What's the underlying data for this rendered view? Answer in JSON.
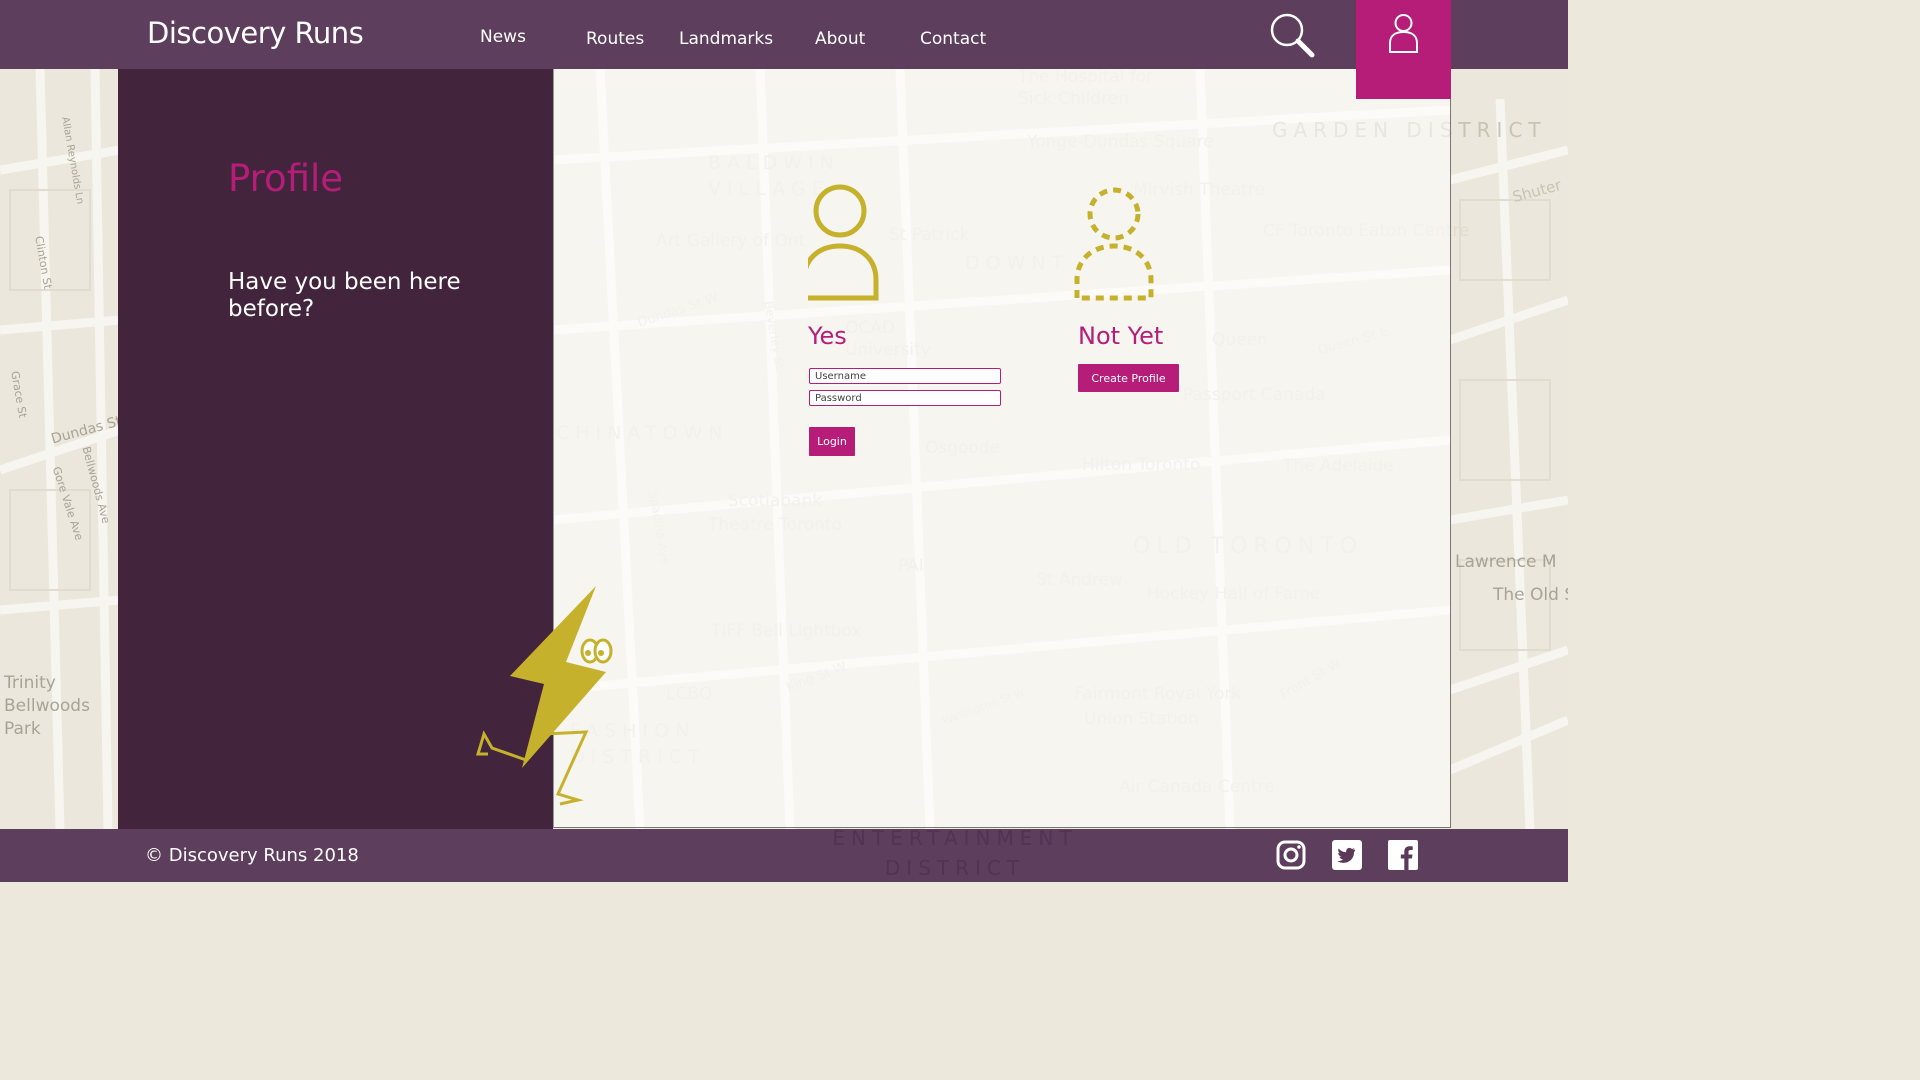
{
  "brand": "Discovery Runs",
  "nav": {
    "items": [
      "News",
      "Routes",
      "Landmarks",
      "About",
      "Contact"
    ]
  },
  "header_icons": {
    "search": "search-icon",
    "profile": "user-icon"
  },
  "side_panel": {
    "title": "Profile",
    "question": "Have you been here before?"
  },
  "login": {
    "title": "Yes",
    "username_placeholder": "Username",
    "password_placeholder": "Password",
    "button_label": "Login"
  },
  "signup": {
    "title": "Not Yet",
    "button_label": "Create Profile"
  },
  "map_labels": {
    "baldwin_village": "BALDWIN VILLAGE",
    "downtown": "DOWNT",
    "garden_district": "GARDEN DISTRICT",
    "chinatown": "CHINATOWN",
    "old_toronto": "OLD TORONTO",
    "fashion_district": "FASHION DISTRICT",
    "entertainment_district": "ENTERTAINMENT DISTRICT",
    "sick_children": "The Hospital for Sick Children",
    "yonge_dundas": "Yonge-Dundas Square",
    "mirvish": "Mirvish Theatre",
    "eaton_centre": "CF Toronto Eaton Centre",
    "art_gallery": "Art Gallery of Ont",
    "st_patrick": "St Patrick",
    "ocad": "OCAD University",
    "dundas_square": "Dundas Square",
    "queen": "Queen",
    "passport_canada": "Passport Canada",
    "osgoode": "Osgoode",
    "hilton": "Hilton Toronto",
    "adelaide": "The Adelaide",
    "scotiabank": "Scotiabank Theatre Toronto",
    "pai": "PAI",
    "st_andrew": "St Andrew",
    "hockey_hall": "Hockey Hall of Fame",
    "tiff": "TIFF Bell Lightbox",
    "lcbo": "LCBO",
    "fairmont": "Fairmont Royal York",
    "union_station": "Union Station",
    "air_canada": "Air Canada Centre",
    "trinity": "Trinity Bellwoods Park",
    "lawrence": "Lawrence M",
    "old_spaghetti": "The Old Spaghet",
    "dundas_st_w": "Dundas St W",
    "king_st_w": "King St W",
    "queen_st_e": "Queen St E",
    "front_st_w": "Front St W",
    "wellington_st_w": "Wellington St W",
    "spadina_ave": "Spadina Ave",
    "beverley_st": "Beverley St",
    "college_st": "College St",
    "shuter_st": "Shuter",
    "allan_reynolds": "Allan Reynolds Ln",
    "gore_vale": "Gore Vale Ave",
    "bellwoods_ave": "Bellwoods Ave",
    "grace_st": "Grace St",
    "clinton_st": "Clinton St"
  },
  "footer": {
    "copyright": "© Discovery Runs 2018",
    "social": [
      "instagram-icon",
      "twitter-icon",
      "facebook-icon"
    ]
  },
  "colors": {
    "header_bg": "#523052",
    "accent": "#b51d78",
    "panel_bg": "#42253d",
    "mascot": "#c6b12c"
  }
}
